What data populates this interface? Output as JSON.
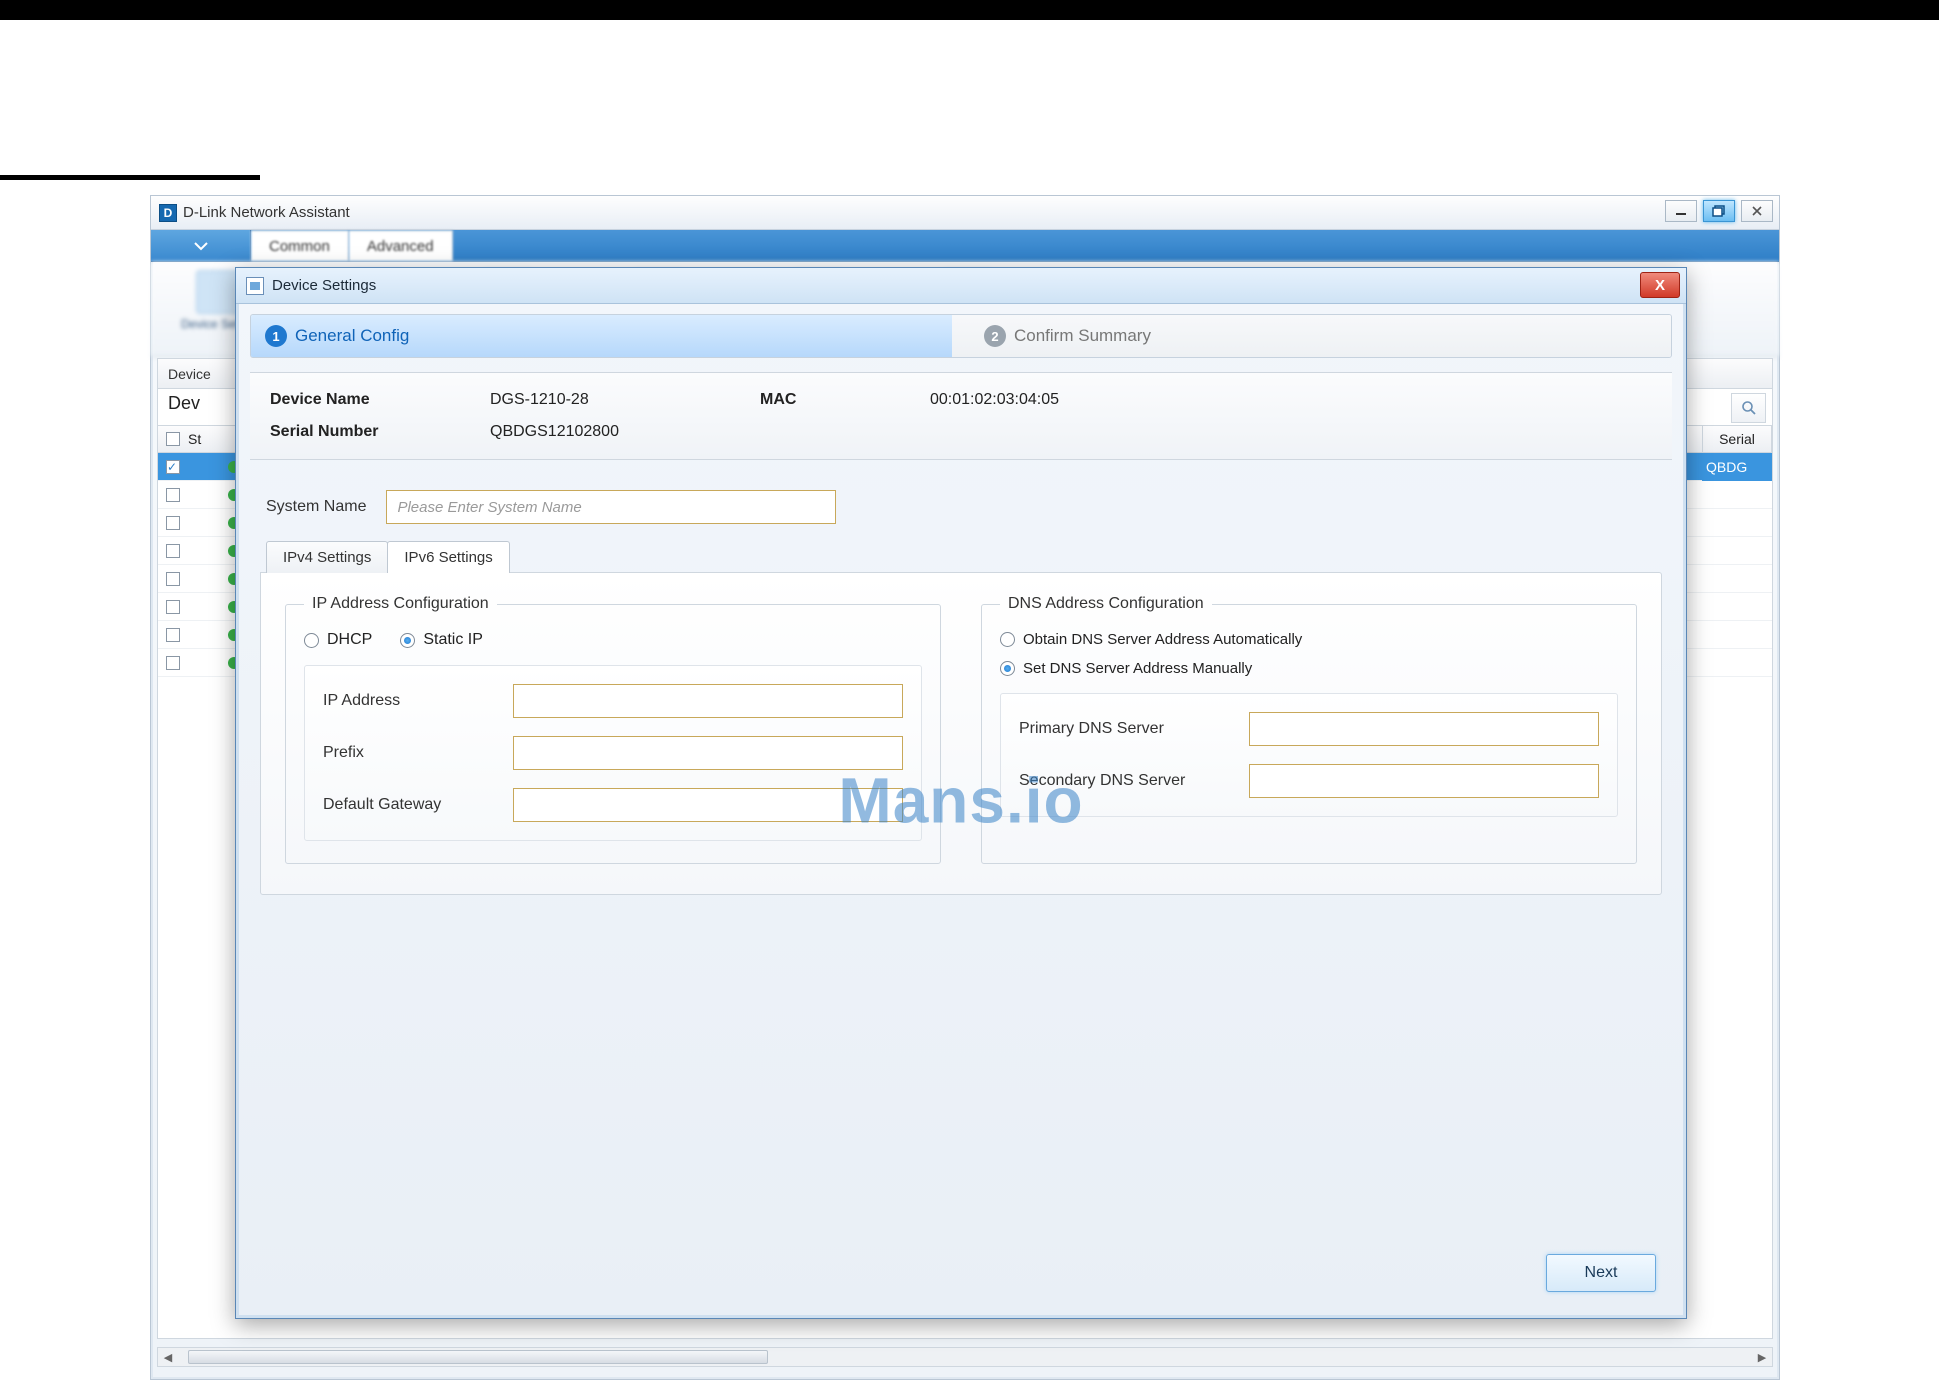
{
  "watermark": "Mans.io",
  "app": {
    "title": "D-Link Network Assistant",
    "logo_letter": "D",
    "ribbon_tabs": [
      "Common",
      "Advanced"
    ],
    "ribbon_button_caption": "Device Settings",
    "table": {
      "header_left": "Device",
      "label": "Dev",
      "header2": "St",
      "serial_header": "Serial",
      "serial_value": "QBDG"
    }
  },
  "modal": {
    "title": "Device Settings",
    "close_glyph": "X",
    "wizard": {
      "step1_num": "1",
      "step1_label": "General Config",
      "step2_num": "2",
      "step2_label": "Confirm Summary"
    },
    "summary": {
      "device_name_label": "Device Name",
      "device_name_value": "DGS-1210-28",
      "mac_label": "MAC",
      "mac_value": "00:01:02:03:04:05",
      "serial_label": "Serial Number",
      "serial_value": "QBDGS12102800"
    },
    "system_name": {
      "label": "System Name",
      "placeholder": "Please Enter System Name",
      "value": ""
    },
    "tabs": {
      "ipv4": "IPv4 Settings",
      "ipv6": "IPv6 Settings",
      "active": "ipv6"
    },
    "ip_group": {
      "legend": "IP Address Configuration",
      "dhcp": "DHCP",
      "static": "Static IP",
      "selected": "static",
      "ip_label": "IP Address",
      "ip_value": "",
      "prefix_label": "Prefix",
      "prefix_value": "",
      "gw_label": "Default Gateway",
      "gw_value": ""
    },
    "dns_group": {
      "legend": "DNS Address Configuration",
      "auto": "Obtain DNS Server Address Automatically",
      "manual": "Set DNS Server Address Manually",
      "selected": "manual",
      "primary_label": "Primary DNS Server",
      "primary_value": "",
      "secondary_label": "Secondary DNS Server",
      "secondary_value": ""
    },
    "next_button": "Next"
  }
}
